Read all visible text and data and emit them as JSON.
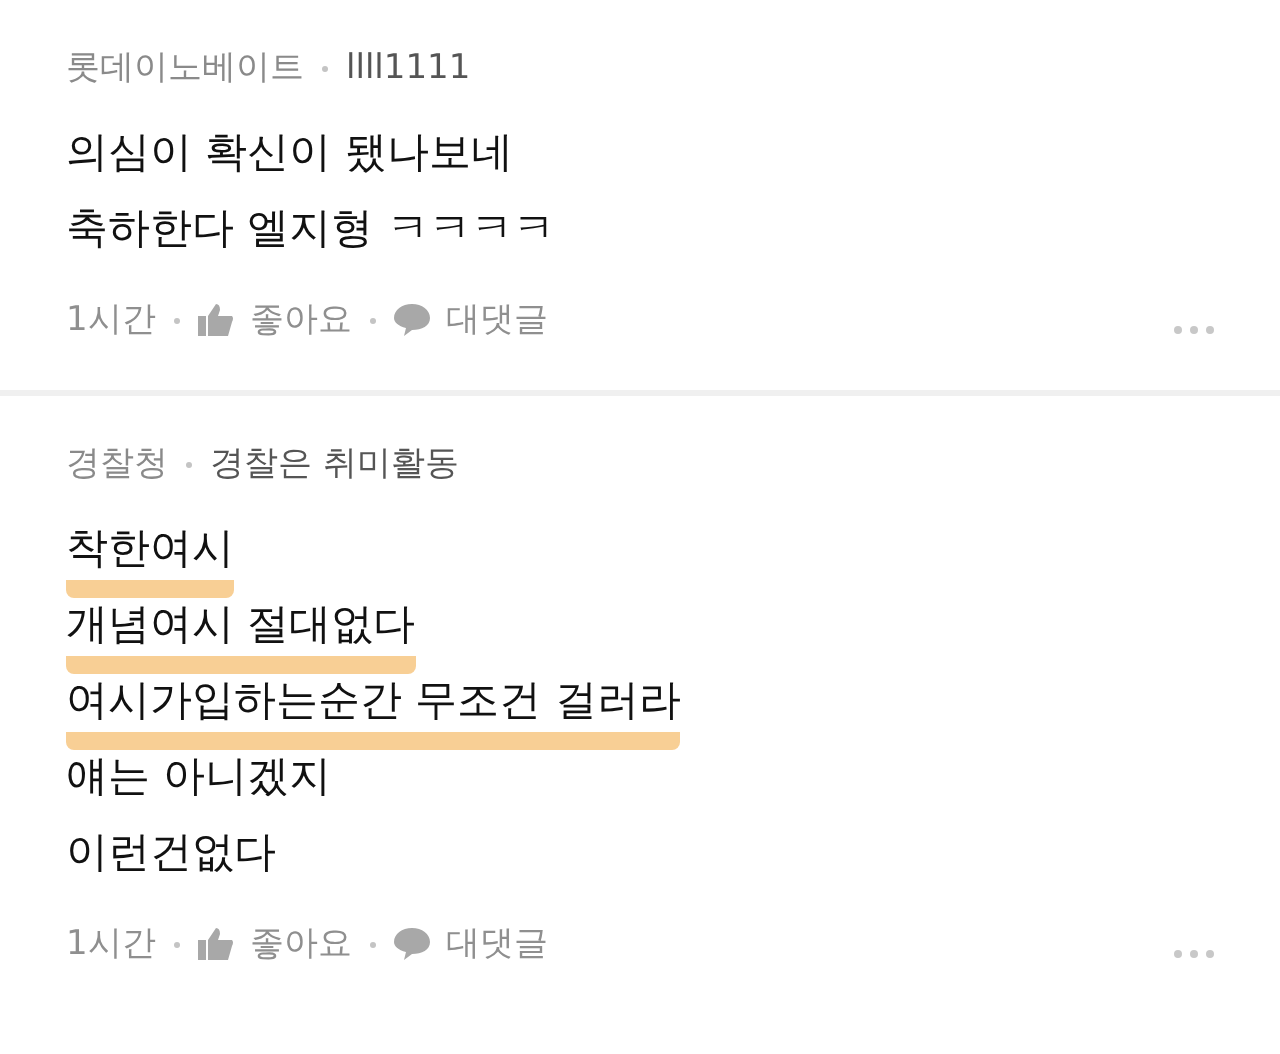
{
  "comments": [
    {
      "author": "롯데이노베이트",
      "subtitle": "llll1111",
      "lines": [
        {
          "text": "의심이 확신이 됐나보네",
          "highlighted": false
        },
        {
          "text": "축하한다 엘지형 ㅋㅋㅋㅋ",
          "highlighted": false
        }
      ],
      "time": "1시간",
      "like": "좋아요",
      "reply": "대댓글"
    },
    {
      "author": "경찰청",
      "subtitle": "경찰은 취미활동",
      "lines": [
        {
          "text": "착한여시",
          "highlighted": true
        },
        {
          "text": "개념여시 절대없다",
          "highlighted": true
        },
        {
          "text": "여시가입하는순간 무조건 걸러라",
          "highlighted": true
        },
        {
          "text": "얘는 아니겠지",
          "highlighted": false
        },
        {
          "text": "이런건없다",
          "highlighted": false
        }
      ],
      "time": "1시간",
      "like": "좋아요",
      "reply": "대댓글"
    }
  ]
}
